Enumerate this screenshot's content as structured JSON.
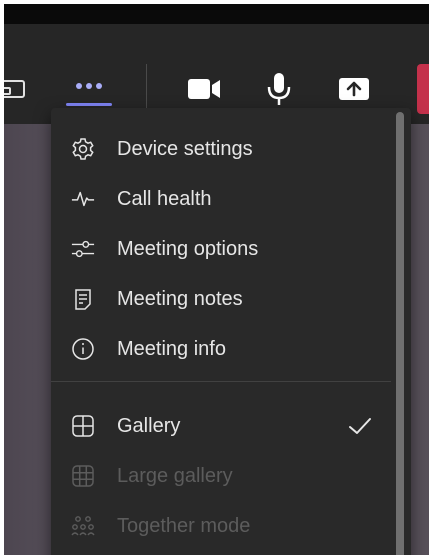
{
  "toolbar": {
    "icons": {
      "share_tray": "share-tray-icon",
      "more": "more-actions-icon",
      "camera": "camera-icon",
      "mic": "microphone-icon",
      "share": "share-content-icon"
    },
    "accent_color": "#7f85f5",
    "leave_color": "#c4314b"
  },
  "menu": {
    "items": [
      {
        "label": "Device settings",
        "icon": "gear-icon"
      },
      {
        "label": "Call health",
        "icon": "pulse-icon"
      },
      {
        "label": "Meeting options",
        "icon": "sliders-icon"
      },
      {
        "label": "Meeting notes",
        "icon": "notes-icon"
      },
      {
        "label": "Meeting info",
        "icon": "info-icon"
      }
    ],
    "view_items": [
      {
        "label": "Gallery",
        "icon": "gallery-icon",
        "selected": true,
        "enabled": true
      },
      {
        "label": "Large gallery",
        "icon": "large-gallery-icon",
        "selected": false,
        "enabled": false
      },
      {
        "label": "Together mode",
        "icon": "together-mode-icon",
        "selected": false,
        "enabled": false
      }
    ]
  }
}
